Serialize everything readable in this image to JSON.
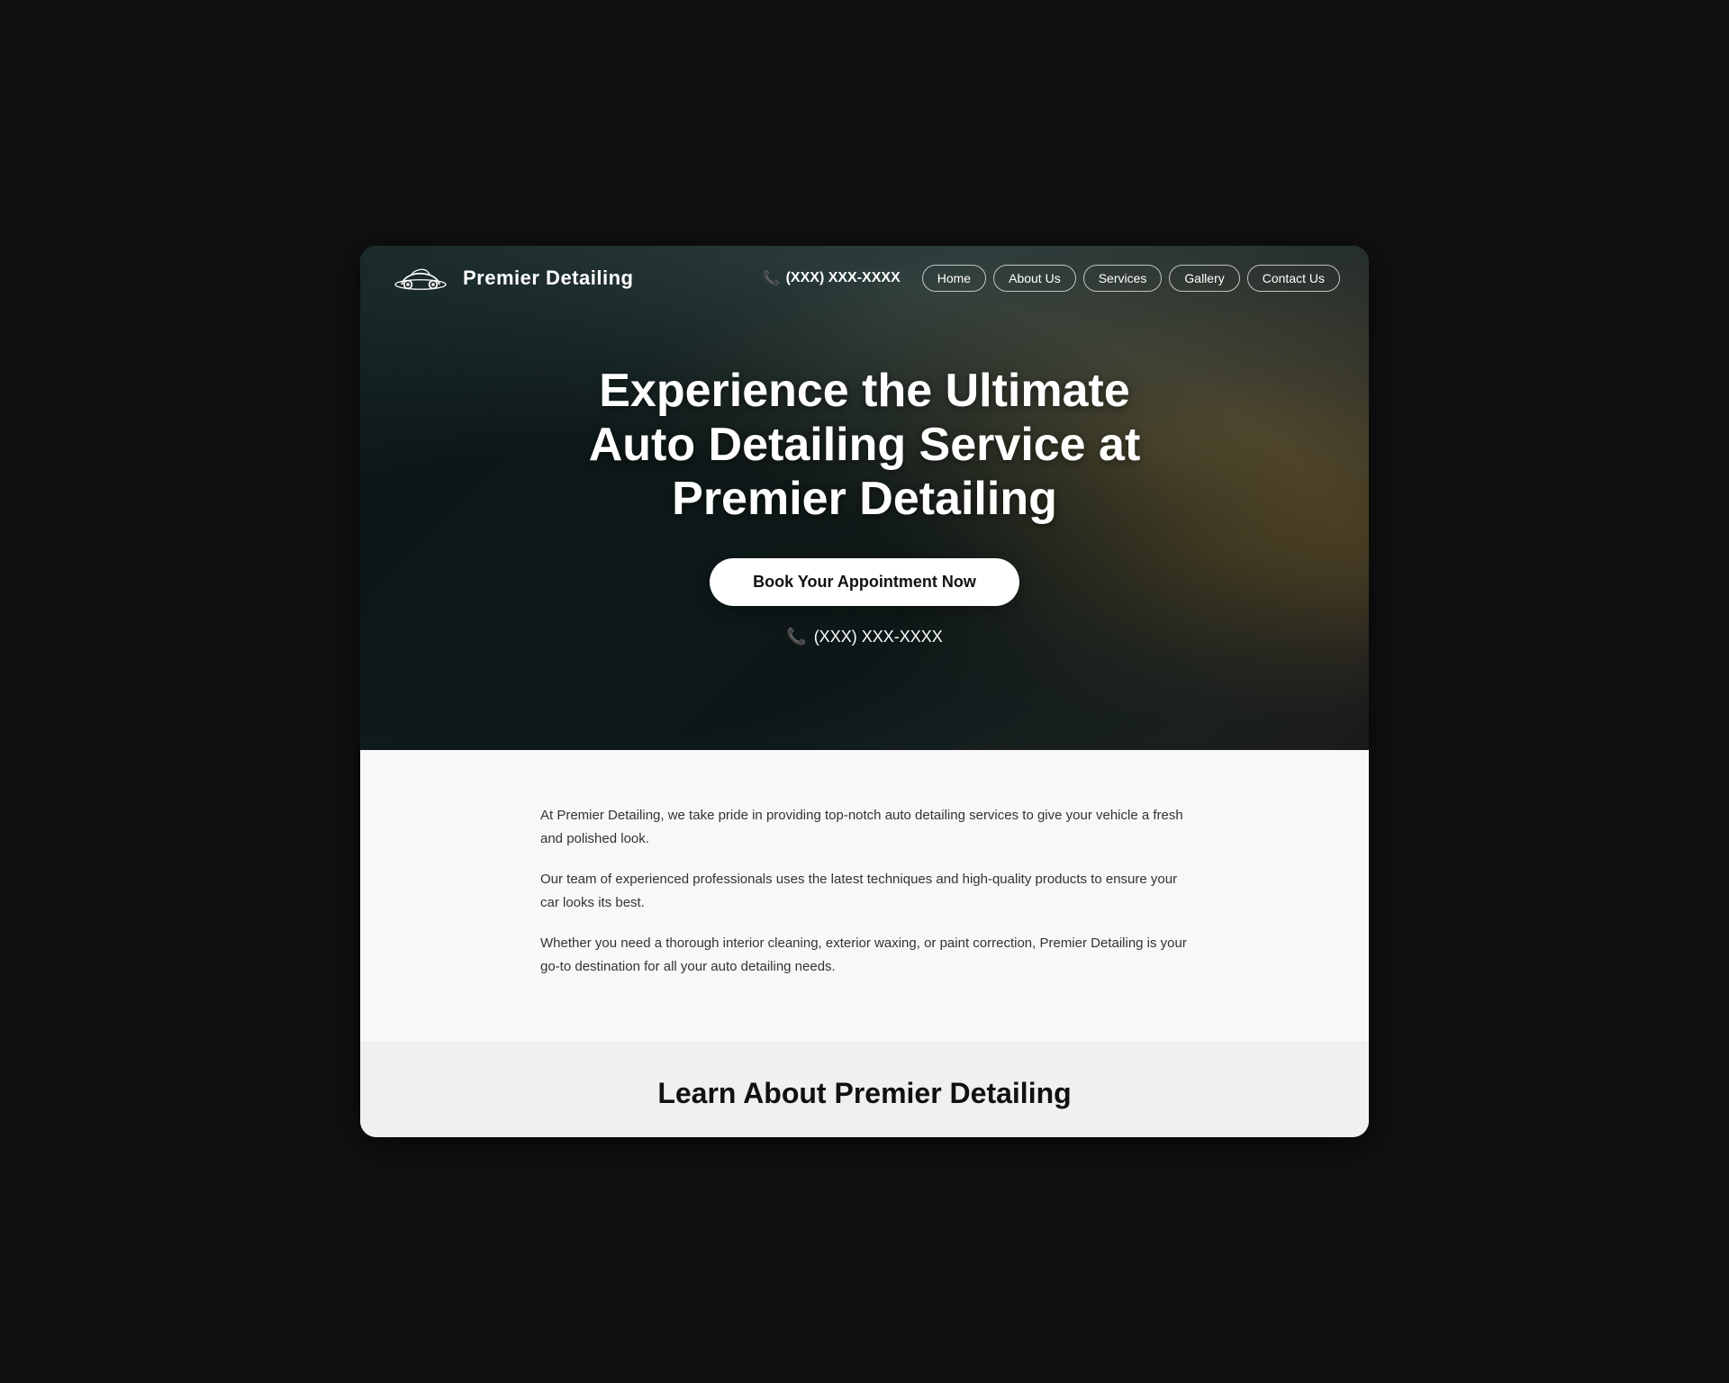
{
  "brand": {
    "name": "Premier Detailing",
    "phone": "(XXX) XXX-XXXX"
  },
  "navbar": {
    "links": [
      {
        "label": "Home",
        "id": "home"
      },
      {
        "label": "About Us",
        "id": "about"
      },
      {
        "label": "Services",
        "id": "services"
      },
      {
        "label": "Gallery",
        "id": "gallery"
      },
      {
        "label": "Contact Us",
        "id": "contact"
      }
    ]
  },
  "hero": {
    "title": "Experience the Ultimate Auto Detailing Service at Premier Detailing",
    "cta_label": "Book Your Appointment Now",
    "phone": "(XXX) XXX-XXXX"
  },
  "content": {
    "paragraphs": [
      "At Premier Detailing, we take pride in providing top-notch auto detailing services to give your vehicle a fresh and polished look.",
      "Our team of experienced professionals uses the latest techniques and high-quality products to ensure your car looks its best.",
      "Whether you need a thorough interior cleaning, exterior waxing, or paint correction, Premier Detailing is your go-to destination for all your auto detailing needs."
    ]
  },
  "learn_section": {
    "title": "Learn About Premier Detailing"
  }
}
